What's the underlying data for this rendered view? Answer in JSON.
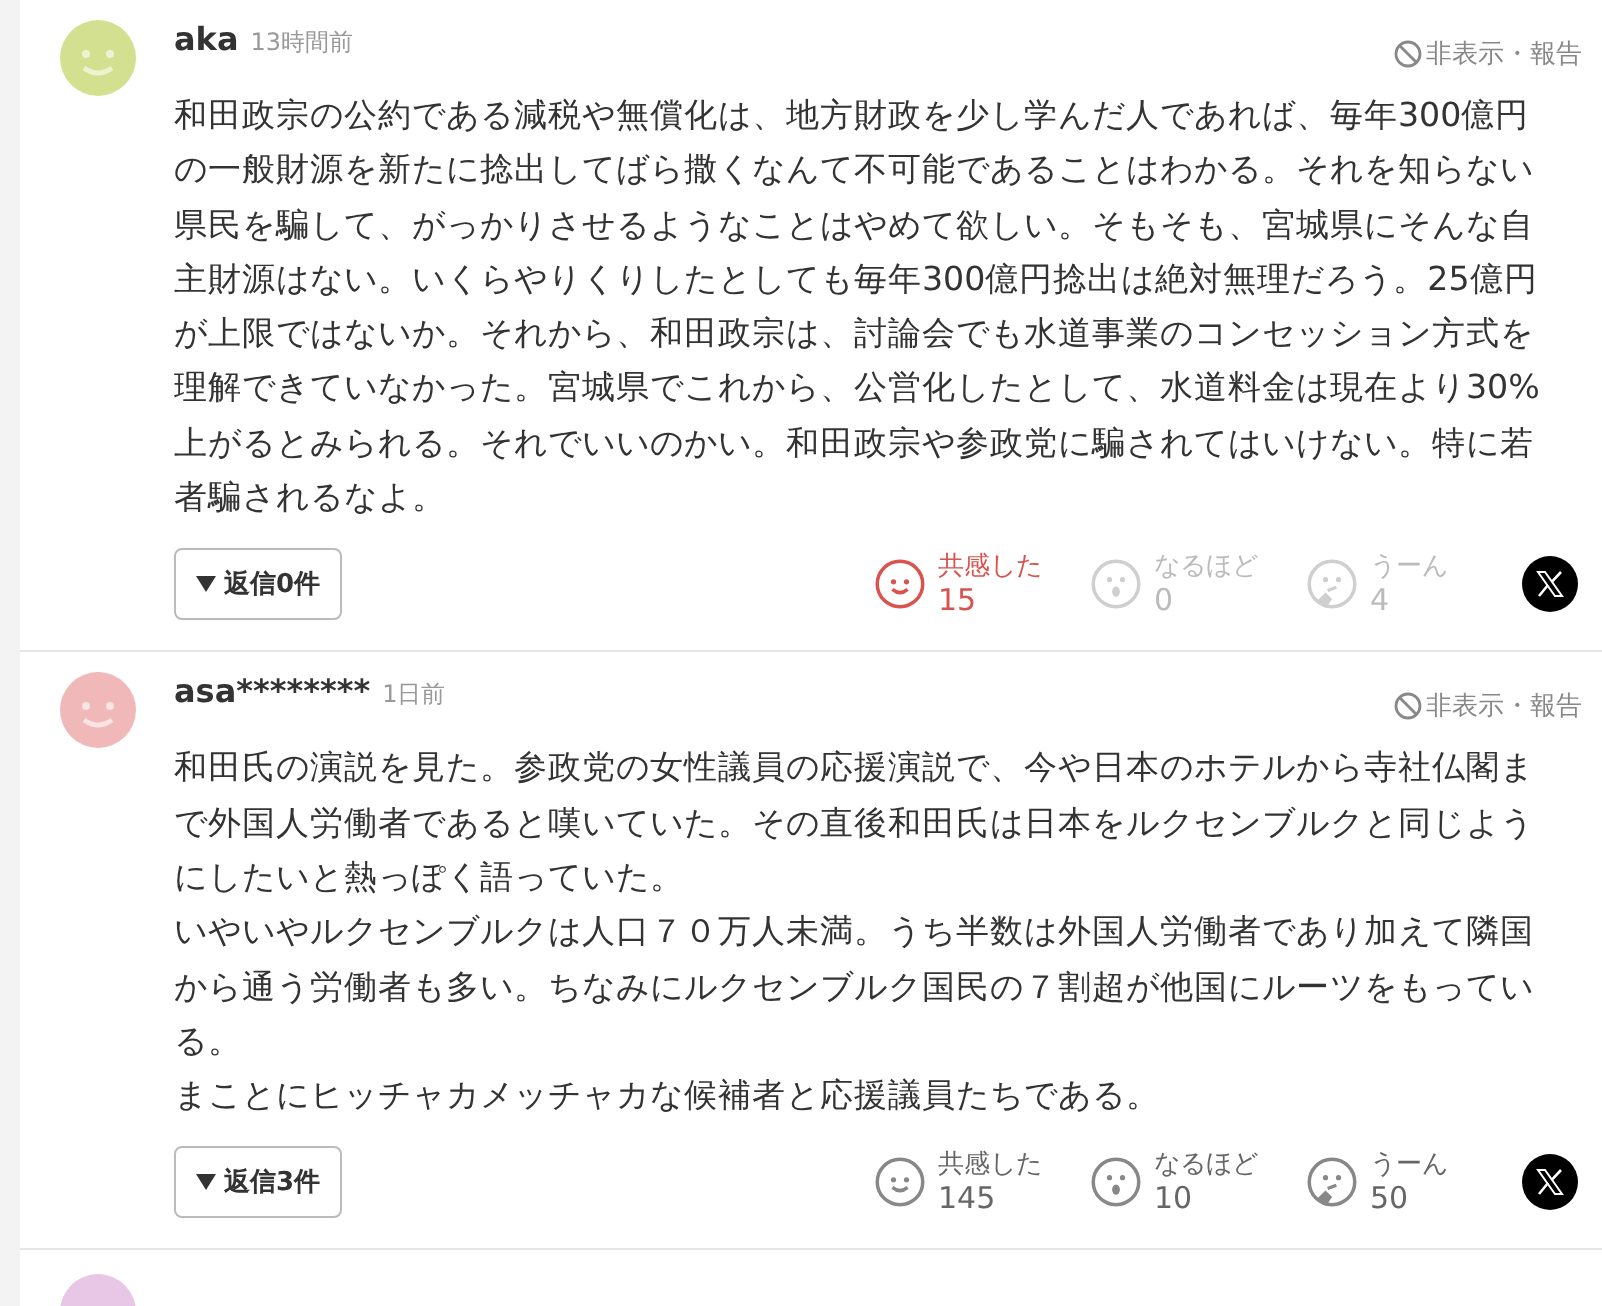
{
  "comments": [
    {
      "user": "aka",
      "time": "13時間前",
      "color": "#d3e08f",
      "report": "非表示・報告",
      "paragraphs": [
        "和田政宗の公約である減税や無償化は、地方財政を少し学んだ人であれば、毎年300億円の一般財源を新たに捻出してばら撒くなんて不可能であることはわかる。それを知らない県民を騙して、がっかりさせるようなことはやめて欲しい。そもそも、宮城県にそんな自主財源はない。いくらやりくりしたとしても毎年300億円捻出は絶対無理だろう。25億円が上限ではないか。それから、和田政宗は、討論会でも水道事業のコンセッション方式を理解できていなかった。宮城県でこれから、公営化したとして、水道料金は現在より30%上がるとみられる。それでいいのかい。和田政宗や参政党に騙されてはいけない。特に若者騙されるなよ。"
      ],
      "replies": "返信0件",
      "reactions": [
        {
          "kind": "empathy",
          "label": "共感した",
          "count": "15",
          "selected": true
        },
        {
          "kind": "insight",
          "label": "なるほど",
          "count": "0",
          "selected": false
        },
        {
          "kind": "hmm",
          "label": "うーん",
          "count": "4",
          "selected": false
        }
      ]
    },
    {
      "user": "asa********",
      "time": "1日前",
      "color": "#f0b8b8",
      "report": "非表示・報告",
      "paragraphs": [
        "和田氏の演説を見た。参政党の女性議員の応援演説で、今や日本のホテルから寺社仏閣まで外国人労働者であると嘆いていた。その直後和田氏は日本をルクセンブルクと同じようにしたいと熱っぽく語っていた。",
        "いやいやルクセンブルクは人口７０万人未満。うち半数は外国人労働者であり加えて隣国から通う労働者も多い。ちなみにルクセンブルク国民の７割超が他国にルーツをもっている。",
        "まことにヒッチャカメッチャカな候補者と応援議員たちである。"
      ],
      "replies": "返信3件",
      "reactions": [
        {
          "kind": "empathy",
          "label": "共感した",
          "count": "145",
          "selected": false
        },
        {
          "kind": "insight",
          "label": "なるほど",
          "count": "10",
          "selected": false
        },
        {
          "kind": "hmm",
          "label": "うーん",
          "count": "50",
          "selected": false
        }
      ]
    }
  ],
  "next_comment": {
    "color": "#e8c6e6"
  }
}
